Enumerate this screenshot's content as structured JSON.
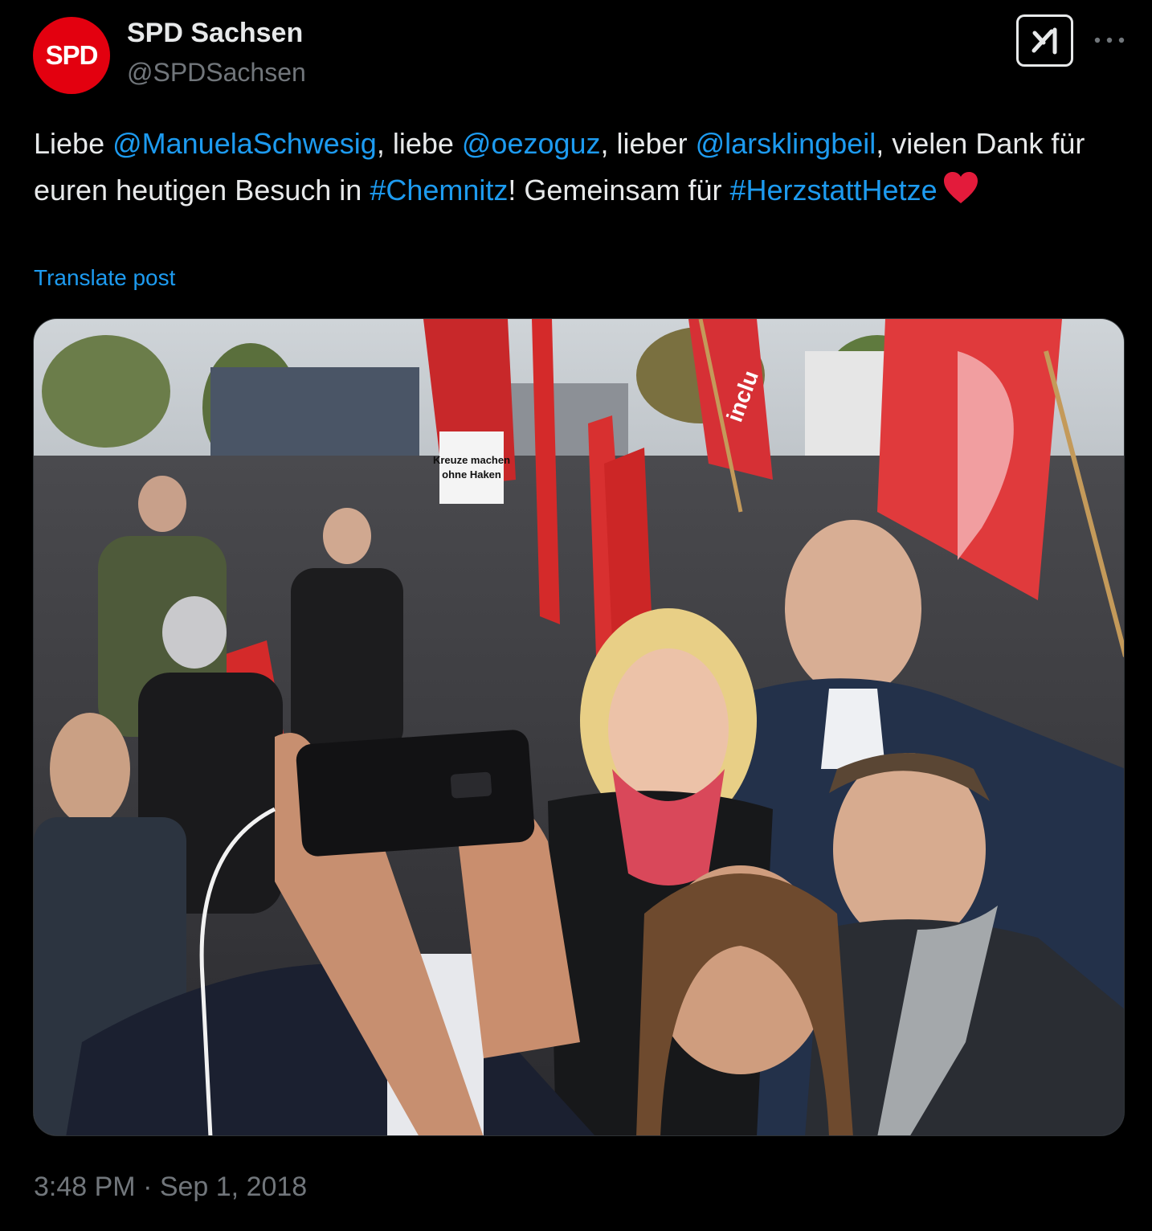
{
  "author": {
    "avatar_text": "SPD",
    "display_name": "SPD Sachsen",
    "handle": "@SPDSachsen"
  },
  "post": {
    "segments": [
      {
        "text": "Liebe ",
        "link": false
      },
      {
        "text": "@ManuelaSchwesig",
        "link": true
      },
      {
        "text": ", liebe ",
        "link": false
      },
      {
        "text": "@oezoguz",
        "link": true
      },
      {
        "text": ", lieber ",
        "link": false
      },
      {
        "text": "@larsklingbeil",
        "link": true
      },
      {
        "text": ", vielen Dank für euren heutigen Besuch in ",
        "link": false
      },
      {
        "text": "#Chemnitz",
        "link": true
      },
      {
        "text": "! Gemeinsam für ",
        "link": false
      },
      {
        "text": "#HerzstattHetze",
        "link": true
      }
    ],
    "translate_label": "Translate post",
    "timestamp": "3:48 PM · Sep 1, 2018"
  },
  "media": {
    "sign_text": [
      "Kreuze machen",
      "ohne Haken"
    ],
    "flag_text": "inclu"
  },
  "colors": {
    "background": "#000000",
    "text": "#e7e9ea",
    "secondary": "#71767b",
    "link": "#1d9bf0",
    "spd_red": "#e3000f",
    "heart": "#f91880"
  },
  "icons": {
    "grok": "grok-icon",
    "more": "more-dots-icon",
    "heart": "red-heart-emoji"
  }
}
